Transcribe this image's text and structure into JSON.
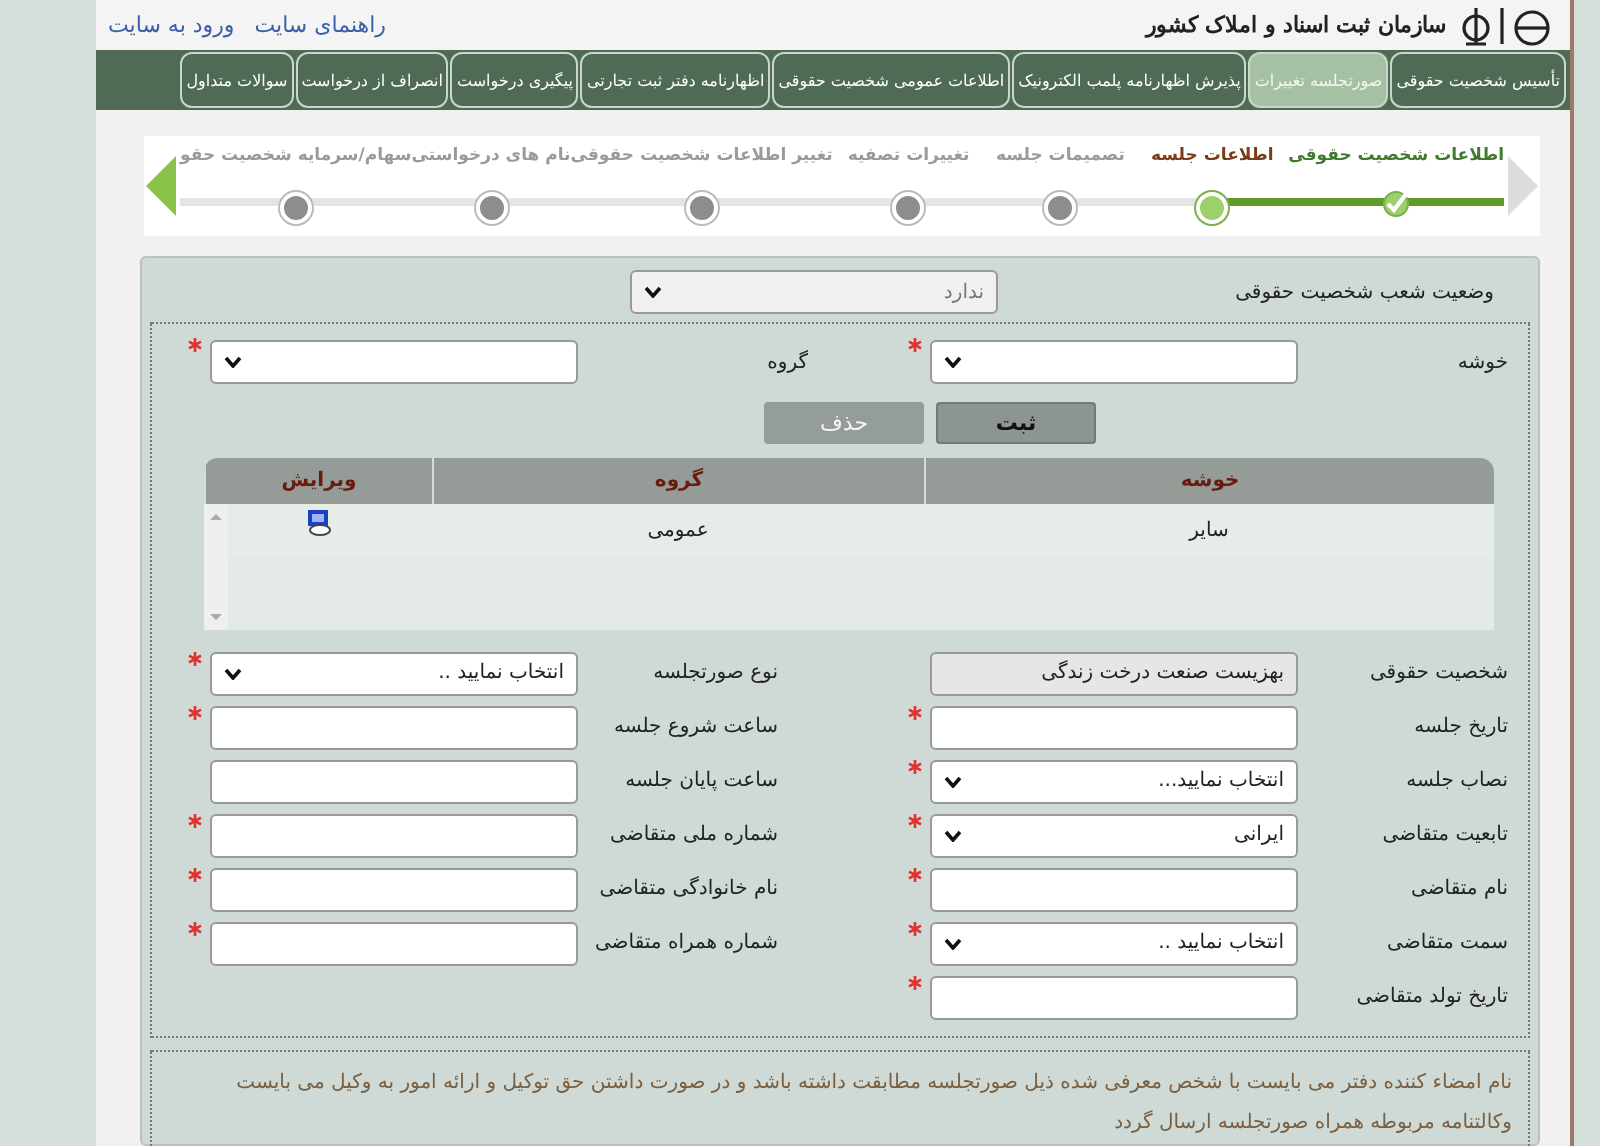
{
  "header": {
    "logo_text": "سازمان ثبت اسناد و املاک کشور",
    "links": [
      "راهنمای سایت",
      "ورود به سایت"
    ]
  },
  "nav": {
    "tabs": [
      {
        "label": "تأسیس شخصیت حقوقی",
        "selected": false
      },
      {
        "label": "صورتجلسه تغییرات",
        "selected": true
      },
      {
        "label": "پذیرش اظهارنامه پلمب الکترونیک",
        "selected": false
      },
      {
        "label": "اطلاعات عمومی شخصیت حقوقی",
        "selected": false
      },
      {
        "label": "اظهارنامه دفتر ثبت تجارتی",
        "selected": false
      },
      {
        "label": "پیگیری درخواست",
        "selected": false
      },
      {
        "label": "انصراف از درخواست",
        "selected": false
      },
      {
        "label": "سوالات متداول",
        "selected": false
      }
    ]
  },
  "steps": [
    {
      "label": "اطلاعات شخصیت حقوقی",
      "done": true,
      "selected": false
    },
    {
      "label": "اطلاعات جلسه",
      "done": false,
      "selected": true
    },
    {
      "label": "تصمیمات جلسه",
      "done": false,
      "selected": false
    },
    {
      "label": "تغییرات تصفیه",
      "done": false,
      "selected": false
    },
    {
      "label": "تغییر اطلاعات شخصیت حقوقی",
      "done": false,
      "selected": false
    },
    {
      "label": "نام های درخواستی",
      "done": false,
      "selected": false
    },
    {
      "label": "سهام/سرمایه شخصیت حقو",
      "done": false,
      "selected": false
    }
  ],
  "branch_status": {
    "label": "وضعیت شعب شخصیت حقوقی",
    "value": "ندارد",
    "disabled": true
  },
  "cluster": {
    "fields": [
      {
        "label": "خوشه",
        "kind": "select",
        "required": true
      },
      {
        "label": "گروه",
        "kind": "select",
        "required": true
      }
    ],
    "buttons": [
      {
        "label": "ثبت",
        "disabled": false
      },
      {
        "label": "حذف",
        "disabled": true
      }
    ],
    "table": {
      "columns": [
        "خوشه",
        "گروه",
        "ویرایش"
      ],
      "rows": [
        {
          "cells": [
            "سایر",
            "عمومی"
          ]
        }
      ]
    }
  },
  "fields": [
    {
      "label": "شخصیت حقوقی",
      "kind": "text",
      "value": "بهزیست صنعت درخت زندگی",
      "readonly": true,
      "required": false
    },
    {
      "label": "نوع صورتجلسه",
      "kind": "select",
      "value": "انتخاب نمایید ..",
      "required": true
    },
    {
      "label": "تاریخ جلسه",
      "kind": "text",
      "required": true
    },
    {
      "label": "ساعت شروع جلسه",
      "kind": "text",
      "required": true
    },
    {
      "label": "نصاب جلسه",
      "kind": "select",
      "value": "انتخاب نمایید...",
      "required": true
    },
    {
      "label": "ساعت پایان جلسه",
      "kind": "text",
      "required": false
    },
    {
      "label": "تابعیت متقاضی",
      "kind": "select",
      "value": "ایرانی",
      "required": true
    },
    {
      "label": "شماره ملی متقاضی",
      "kind": "text",
      "required": true
    },
    {
      "label": "نام متقاضی",
      "kind": "text",
      "required": true
    },
    {
      "label": "نام خانوادگی متقاضی",
      "kind": "text",
      "required": true
    },
    {
      "label": "سمت متقاضی",
      "kind": "select",
      "value": "انتخاب نمایید ..",
      "required": true
    },
    {
      "label": "شماره همراه متقاضی",
      "kind": "text",
      "required": true
    },
    {
      "label": "تاریخ تولد متقاضی",
      "kind": "text",
      "required": true
    }
  ],
  "note": "نام امضاء کننده دفتر می بایست با شخص معرفی شده ذیل صورتجلسه مطابقت داشته باشد و در صورت داشتن حق توکیل و ارائه امور به وکیل می بایست وکالتنامه مربوطه همراه صورتجلسه ارسال گردد"
}
